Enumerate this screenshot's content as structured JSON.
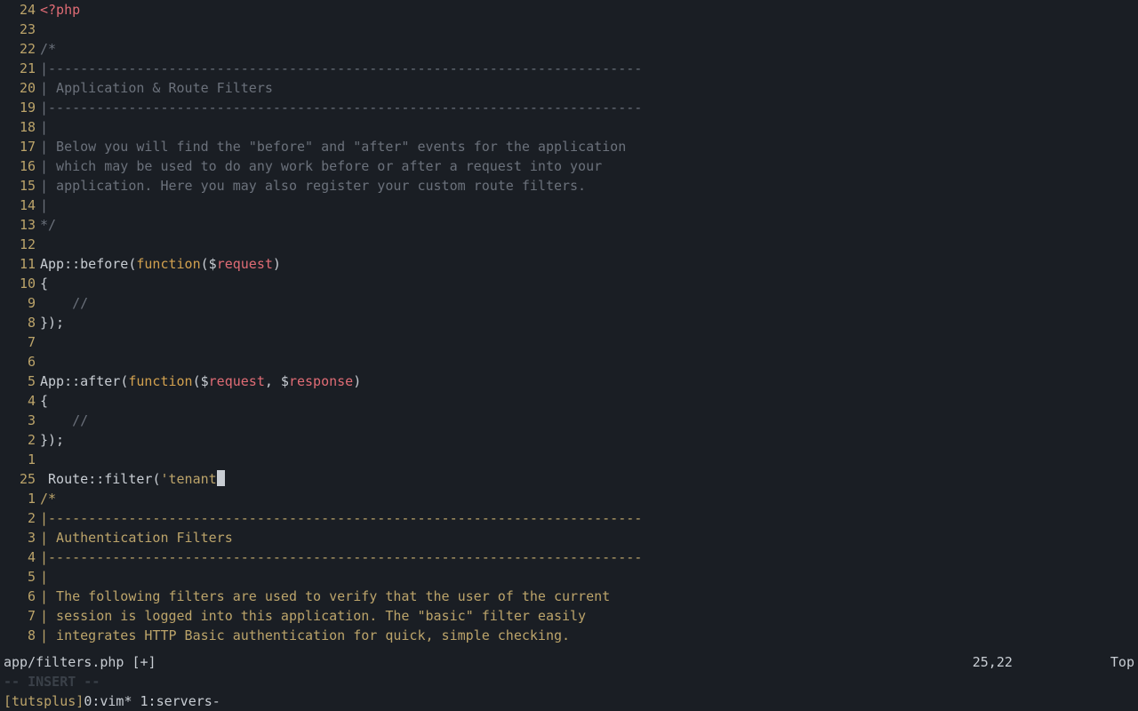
{
  "editor": {
    "lines": [
      {
        "num": "24",
        "tokens": [
          {
            "cls": "c-tag",
            "t": "<?php"
          }
        ]
      },
      {
        "num": "23",
        "tokens": []
      },
      {
        "num": "22",
        "tokens": [
          {
            "cls": "c-comment",
            "t": "/*"
          }
        ]
      },
      {
        "num": "21",
        "tokens": [
          {
            "cls": "c-comment",
            "t": "|--------------------------------------------------------------------------"
          }
        ]
      },
      {
        "num": "20",
        "tokens": [
          {
            "cls": "c-comment",
            "t": "| Application & Route Filters"
          }
        ]
      },
      {
        "num": "19",
        "tokens": [
          {
            "cls": "c-comment",
            "t": "|--------------------------------------------------------------------------"
          }
        ]
      },
      {
        "num": "18",
        "tokens": [
          {
            "cls": "c-comment",
            "t": "|"
          }
        ]
      },
      {
        "num": "17",
        "tokens": [
          {
            "cls": "c-comment",
            "t": "| Below you will find the \"before\" and \"after\" events for the application"
          }
        ]
      },
      {
        "num": "16",
        "tokens": [
          {
            "cls": "c-comment",
            "t": "| which may be used to do any work before or after a request into your"
          }
        ]
      },
      {
        "num": "15",
        "tokens": [
          {
            "cls": "c-comment",
            "t": "| application. Here you may also register your custom route filters."
          }
        ]
      },
      {
        "num": "14",
        "tokens": [
          {
            "cls": "c-comment",
            "t": "|"
          }
        ]
      },
      {
        "num": "13",
        "tokens": [
          {
            "cls": "c-comment",
            "t": "*/"
          }
        ]
      },
      {
        "num": "12",
        "tokens": []
      },
      {
        "num": "11",
        "tokens": [
          {
            "cls": "c-func",
            "t": "App"
          },
          {
            "cls": "c-plain",
            "t": "::"
          },
          {
            "cls": "c-func",
            "t": "before"
          },
          {
            "cls": "c-paren",
            "t": "("
          },
          {
            "cls": "c-kw",
            "t": "function"
          },
          {
            "cls": "c-paren",
            "t": "("
          },
          {
            "cls": "c-plain",
            "t": "$"
          },
          {
            "cls": "c-var",
            "t": "request"
          },
          {
            "cls": "c-paren",
            "t": ")"
          }
        ]
      },
      {
        "num": "10",
        "tokens": [
          {
            "cls": "c-plain",
            "t": "{"
          }
        ]
      },
      {
        "num": "9",
        "tokens": [
          {
            "cls": "c-comment",
            "t": "    //"
          }
        ]
      },
      {
        "num": "8",
        "tokens": [
          {
            "cls": "c-plain",
            "t": "});"
          }
        ]
      },
      {
        "num": "7",
        "tokens": []
      },
      {
        "num": "6",
        "tokens": []
      },
      {
        "num": "5",
        "tokens": [
          {
            "cls": "c-func",
            "t": "App"
          },
          {
            "cls": "c-plain",
            "t": "::"
          },
          {
            "cls": "c-func",
            "t": "after"
          },
          {
            "cls": "c-paren",
            "t": "("
          },
          {
            "cls": "c-kw",
            "t": "function"
          },
          {
            "cls": "c-paren",
            "t": "("
          },
          {
            "cls": "c-plain",
            "t": "$"
          },
          {
            "cls": "c-var",
            "t": "request"
          },
          {
            "cls": "c-plain",
            "t": ", $"
          },
          {
            "cls": "c-var",
            "t": "response"
          },
          {
            "cls": "c-paren",
            "t": ")"
          }
        ]
      },
      {
        "num": "4",
        "tokens": [
          {
            "cls": "c-plain",
            "t": "{"
          }
        ]
      },
      {
        "num": "3",
        "tokens": [
          {
            "cls": "c-comment",
            "t": "    //"
          }
        ]
      },
      {
        "num": "2",
        "tokens": [
          {
            "cls": "c-plain",
            "t": "});"
          }
        ]
      },
      {
        "num": "1",
        "tokens": []
      },
      {
        "num": "25",
        "tokens": [
          {
            "cls": "c-plain",
            "t": " "
          },
          {
            "cls": "c-func",
            "t": "Route"
          },
          {
            "cls": "c-plain",
            "t": "::"
          },
          {
            "cls": "c-func",
            "t": "filter"
          },
          {
            "cls": "c-paren",
            "t": "("
          },
          {
            "cls": "c-str",
            "t": "'tenant"
          },
          {
            "cursor": true
          }
        ]
      },
      {
        "num": "1",
        "tokens": [
          {
            "cls": "c-commentY",
            "t": "/*"
          }
        ]
      },
      {
        "num": "2",
        "tokens": [
          {
            "cls": "c-commentY",
            "t": "|--------------------------------------------------------------------------"
          }
        ]
      },
      {
        "num": "3",
        "tokens": [
          {
            "cls": "c-commentY",
            "t": "| Authentication Filters"
          }
        ]
      },
      {
        "num": "4",
        "tokens": [
          {
            "cls": "c-commentY",
            "t": "|--------------------------------------------------------------------------"
          }
        ]
      },
      {
        "num": "5",
        "tokens": [
          {
            "cls": "c-commentY",
            "t": "|"
          }
        ]
      },
      {
        "num": "6",
        "tokens": [
          {
            "cls": "c-commentY",
            "t": "| The following filters are used to verify that the user of the current"
          }
        ]
      },
      {
        "num": "7",
        "tokens": [
          {
            "cls": "c-commentY",
            "t": "| session is logged into this application. The \"basic\" filter easily"
          }
        ]
      },
      {
        "num": "8",
        "tokens": [
          {
            "cls": "c-commentY",
            "t": "| integrates HTTP Basic authentication for quick, simple checking."
          }
        ]
      }
    ]
  },
  "statusbar": {
    "filename": "app/filters.php [+]",
    "position": "25,22",
    "scroll": "Top"
  },
  "modebar": {
    "text": "-- INSERT --"
  },
  "tmux": {
    "session": "[tutsplus]",
    "windows": " 0:vim* 1:servers-"
  }
}
